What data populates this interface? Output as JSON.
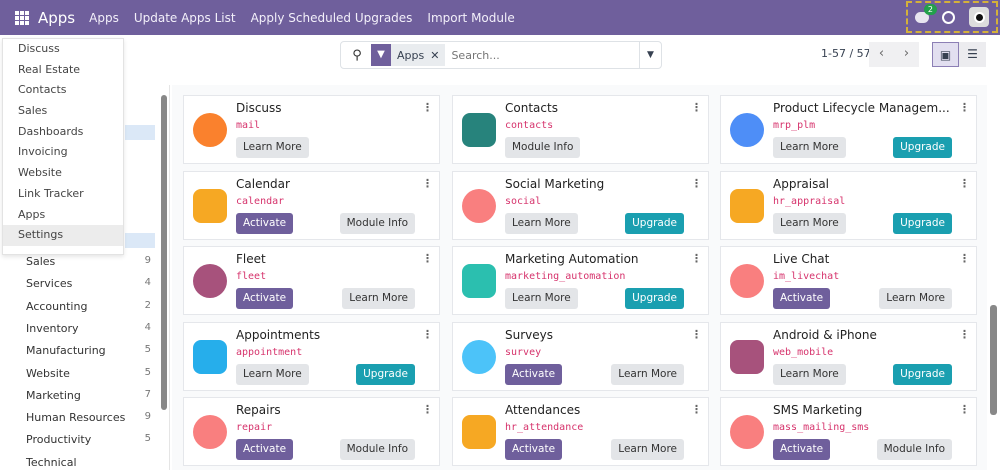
{
  "topbar": {
    "brand": "Apps",
    "links": [
      "Apps",
      "Update Apps List",
      "Apply Scheduled Upgrades",
      "Import Module"
    ],
    "chat_count": "2"
  },
  "search": {
    "facet": "Apps",
    "placeholder": "Search..."
  },
  "pager": {
    "text": "1-57 / 57"
  },
  "menu": [
    "Discuss",
    "Real Estate",
    "Contacts",
    "Sales",
    "Dashboards",
    "Invoicing",
    "Website",
    "Link Tracker",
    "Apps",
    "Settings"
  ],
  "categories": [
    {
      "name": "Sales",
      "count": "9"
    },
    {
      "name": "Services",
      "count": "4"
    },
    {
      "name": "Accounting",
      "count": "2"
    },
    {
      "name": "Inventory",
      "count": "4"
    },
    {
      "name": "Manufacturing",
      "count": "5"
    },
    {
      "name": "Website",
      "count": "5"
    },
    {
      "name": "Marketing",
      "count": "7"
    },
    {
      "name": "Human Resources",
      "count": "9"
    },
    {
      "name": "Productivity",
      "count": "5"
    },
    {
      "name": "Technical",
      "count": ""
    }
  ],
  "apps": [
    {
      "name": "Discuss",
      "tech": "mail",
      "left": "Learn More",
      "right": "",
      "color": "#f97316"
    },
    {
      "name": "Contacts",
      "tech": "contacts",
      "left": "Module Info",
      "right": "",
      "color": "#0f766e"
    },
    {
      "name": "Product Lifecycle Managem...",
      "tech": "mrp_plm",
      "left": "Learn More",
      "right": "Upgrade",
      "color": "#3b82f6"
    },
    {
      "name": "Calendar",
      "tech": "calendar",
      "left": "Activate",
      "right": "Module Info",
      "color": "#f59e0b"
    },
    {
      "name": "Social Marketing",
      "tech": "social",
      "left": "Learn More",
      "right": "Upgrade",
      "color": "#f87171"
    },
    {
      "name": "Appraisal",
      "tech": "hr_appraisal",
      "left": "Learn More",
      "right": "Upgrade",
      "color": "#f59e0b"
    },
    {
      "name": "Fleet",
      "tech": "fleet",
      "left": "Activate",
      "right": "Learn More",
      "color": "#9d3f6e"
    },
    {
      "name": "Marketing Automation",
      "tech": "marketing_automation",
      "left": "Learn More",
      "right": "Upgrade",
      "color": "#14b8a6"
    },
    {
      "name": "Live Chat",
      "tech": "im_livechat",
      "left": "Activate",
      "right": "Learn More",
      "color": "#f87171"
    },
    {
      "name": "Appointments",
      "tech": "appointment",
      "left": "Learn More",
      "right": "Upgrade",
      "color": "#0ea5e9"
    },
    {
      "name": "Surveys",
      "tech": "survey",
      "left": "Activate",
      "right": "Learn More",
      "color": "#38bdf8"
    },
    {
      "name": "Android & iPhone",
      "tech": "web_mobile",
      "left": "Learn More",
      "right": "Upgrade",
      "color": "#9d3f6e"
    },
    {
      "name": "Repairs",
      "tech": "repair",
      "left": "Activate",
      "right": "Module Info",
      "color": "#f87171"
    },
    {
      "name": "Attendances",
      "tech": "hr_attendance",
      "left": "Activate",
      "right": "Learn More",
      "color": "#f59e0b"
    },
    {
      "name": "SMS Marketing",
      "tech": "mass_mailing_sms",
      "left": "Activate",
      "right": "Module Info",
      "color": "#f87171"
    }
  ]
}
